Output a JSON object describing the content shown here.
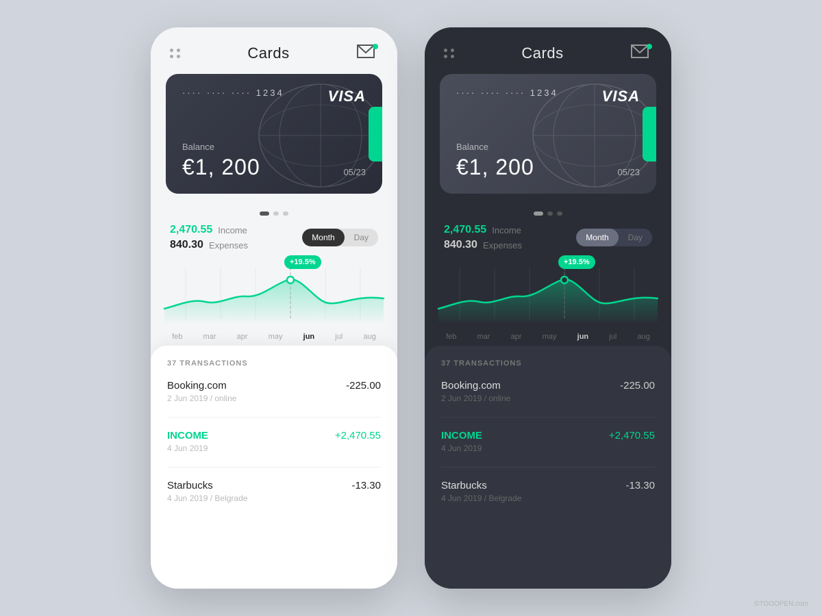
{
  "app": {
    "title": "Cards",
    "themes": [
      "light",
      "dark"
    ]
  },
  "header": {
    "title": "Cards",
    "notification_dot": true
  },
  "card": {
    "number_masked": "····  ····  ····  1234",
    "network": "VISA",
    "balance_label": "Balance",
    "balance_amount": "€1, 200",
    "expiry": "05/23"
  },
  "pagination": {
    "dots": [
      true,
      false,
      false
    ]
  },
  "stats": {
    "income_amount": "2,470.55",
    "income_label": "Income",
    "expense_amount": "840.30",
    "expense_label": "Expenses",
    "toggle_options": [
      "Month",
      "Day"
    ],
    "active_toggle": "Month"
  },
  "chart": {
    "labels": [
      "feb",
      "mar",
      "apr",
      "may",
      "jun",
      "jul",
      "aug"
    ],
    "active_label": "jun",
    "tooltip": "+19.5%"
  },
  "transactions": {
    "header": "37 TRANSACTIONS",
    "items": [
      {
        "name": "Booking.com",
        "date": "2 Jun 2019 / online",
        "amount": "-225.00",
        "type": "expense"
      },
      {
        "name": "INCOME",
        "date": "4 Jun 2019",
        "amount": "+2,470.55",
        "type": "income"
      },
      {
        "name": "Starbucks",
        "date": "4 Jun 2019 / Belgrade",
        "amount": "-13.30",
        "type": "expense"
      }
    ]
  },
  "watermark": "©TOOOPEN.com"
}
